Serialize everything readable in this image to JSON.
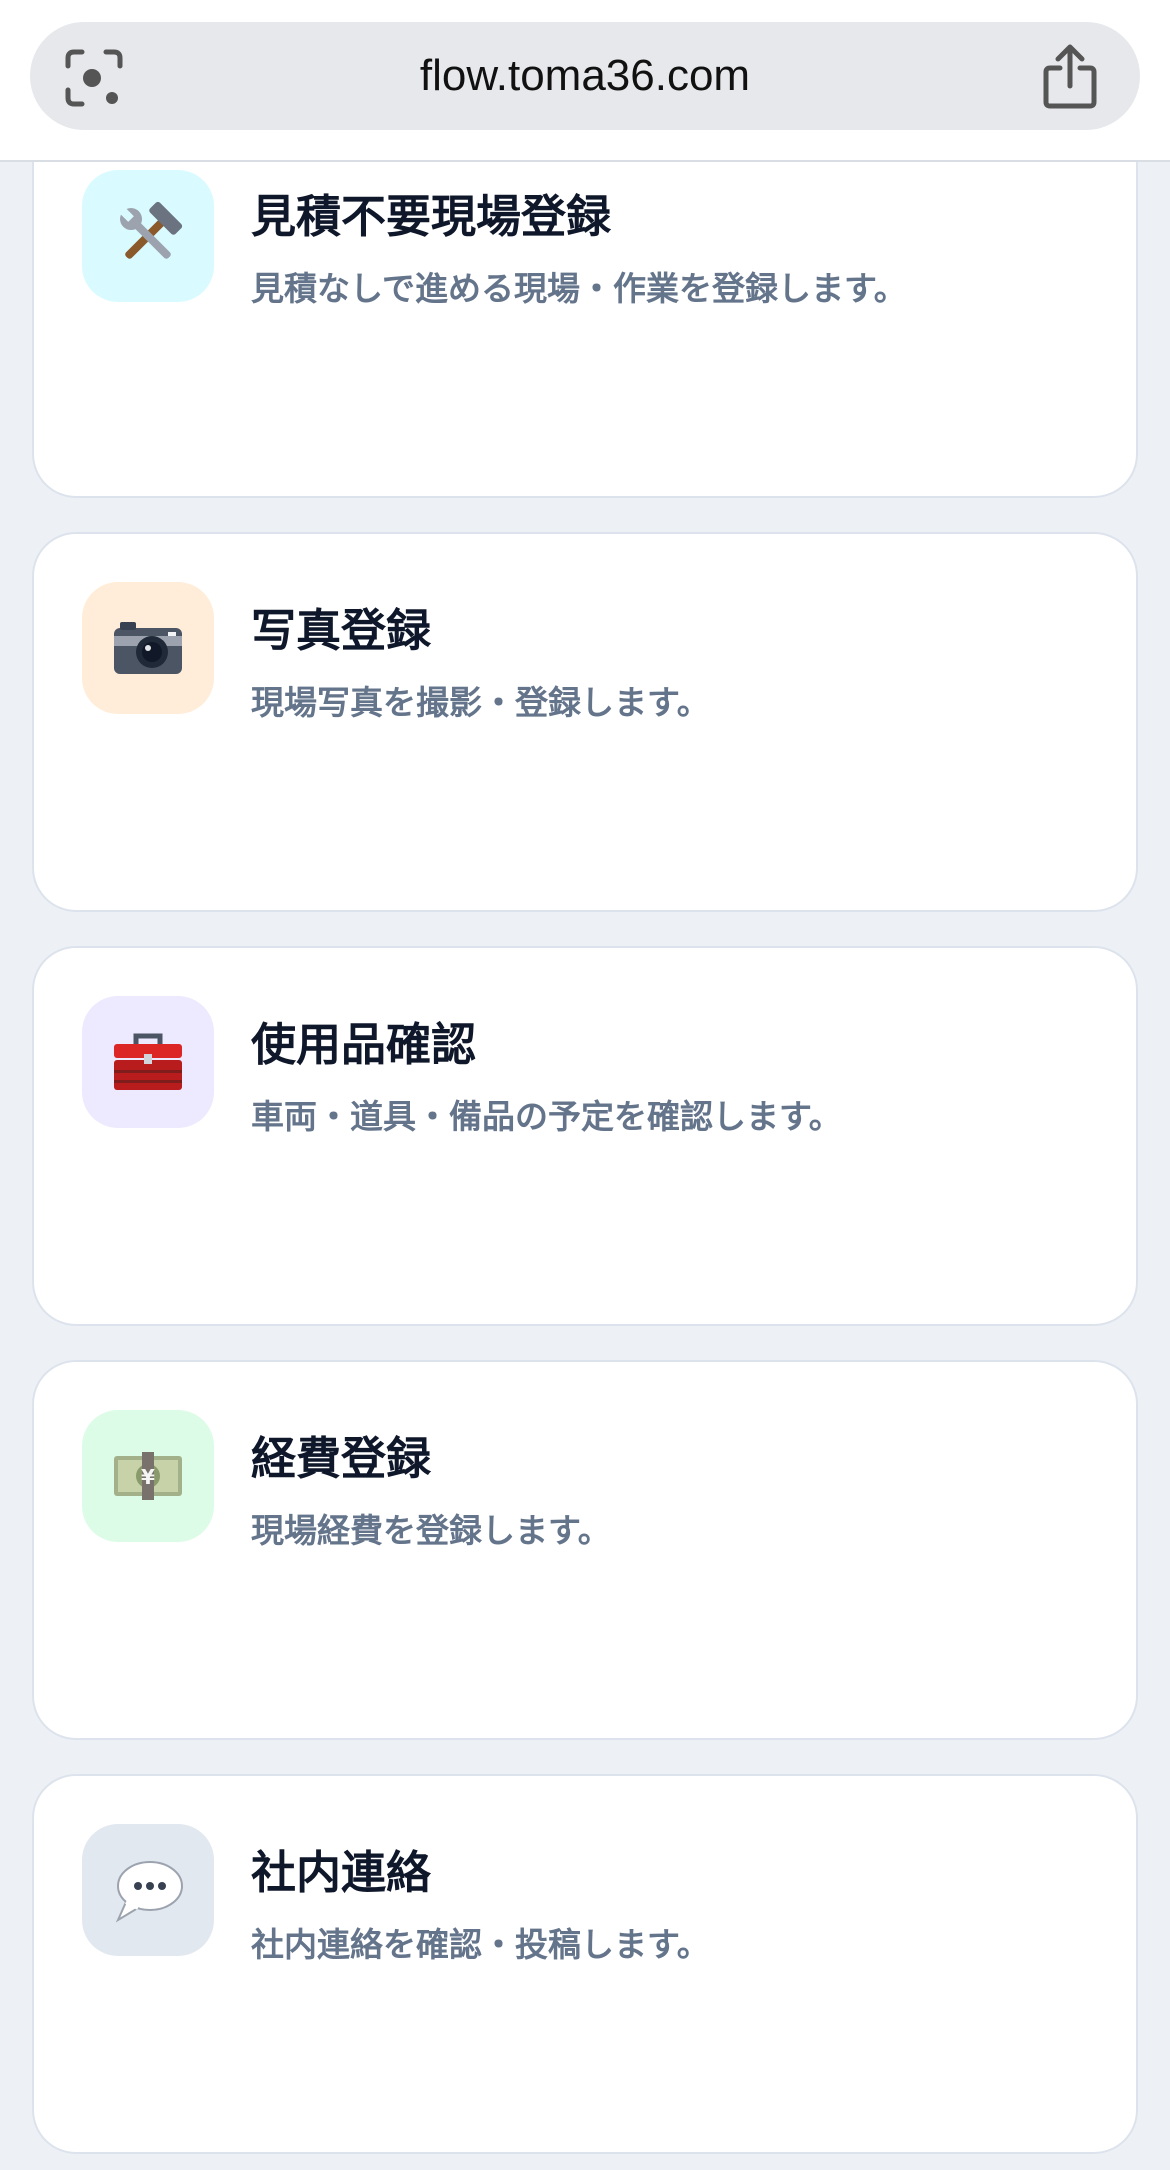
{
  "browser": {
    "url": "flow.toma36.com"
  },
  "menu": {
    "items": [
      {
        "title": "見積不要現場登録",
        "description": "見積なしで進める現場・作業を登録します。",
        "icon": "hammer-wrench-icon",
        "icon_bg": "#d9fbff"
      },
      {
        "title": "写真登録",
        "description": "現場写真を撮影・登録します。",
        "icon": "camera-icon",
        "icon_bg": "#ffedd9"
      },
      {
        "title": "使用品確認",
        "description": "車両・道具・備品の予定を確認します。",
        "icon": "toolbox-icon",
        "icon_bg": "#ede9fe"
      },
      {
        "title": "経費登録",
        "description": "現場経費を登録します。",
        "icon": "yen-banknote-icon",
        "icon_bg": "#dcfce7"
      },
      {
        "title": "社内連絡",
        "description": "社内連絡を確認・投稿します。",
        "icon": "speech-bubble-icon",
        "icon_bg": "#e2e8f0"
      }
    ]
  }
}
